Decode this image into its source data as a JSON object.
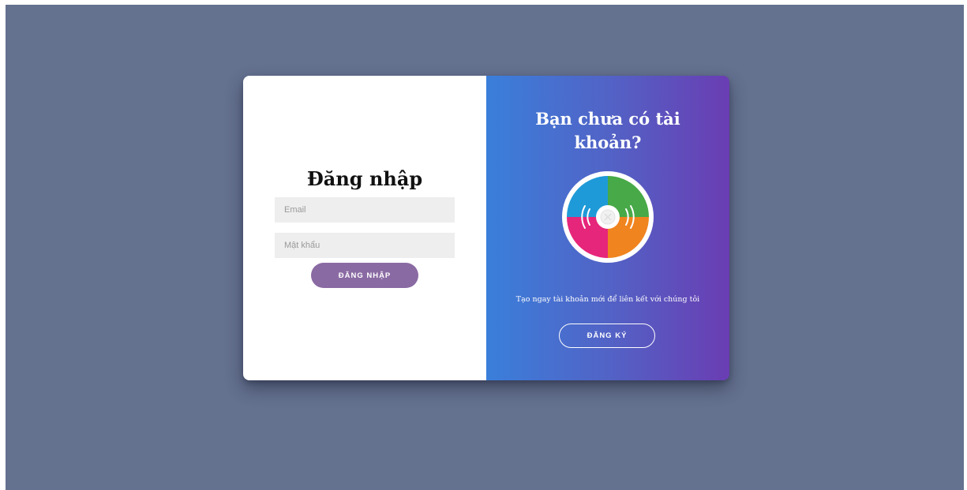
{
  "login": {
    "title": "Đăng nhập",
    "email_placeholder": "Email",
    "password_placeholder": "Mật khẩu",
    "submit_label": "ĐĂNG NHẬP"
  },
  "signup": {
    "title": "Bạn chưa có tài khoản?",
    "description": "Tạo ngay tài khoản mới để liên kết với chúng tôi",
    "button_label": "ĐĂNG KÝ",
    "illustration_icon": "vinyl-disc-icon"
  },
  "colors": {
    "background": "#64718f",
    "login_button": "#8a6aa3",
    "gradient_start": "#3a7fdb",
    "gradient_end": "#6a3db3",
    "input_background": "#eeeeee",
    "disc_segments": [
      "#47a947",
      "#f0841f",
      "#e6267a",
      "#1f9ad8"
    ]
  }
}
